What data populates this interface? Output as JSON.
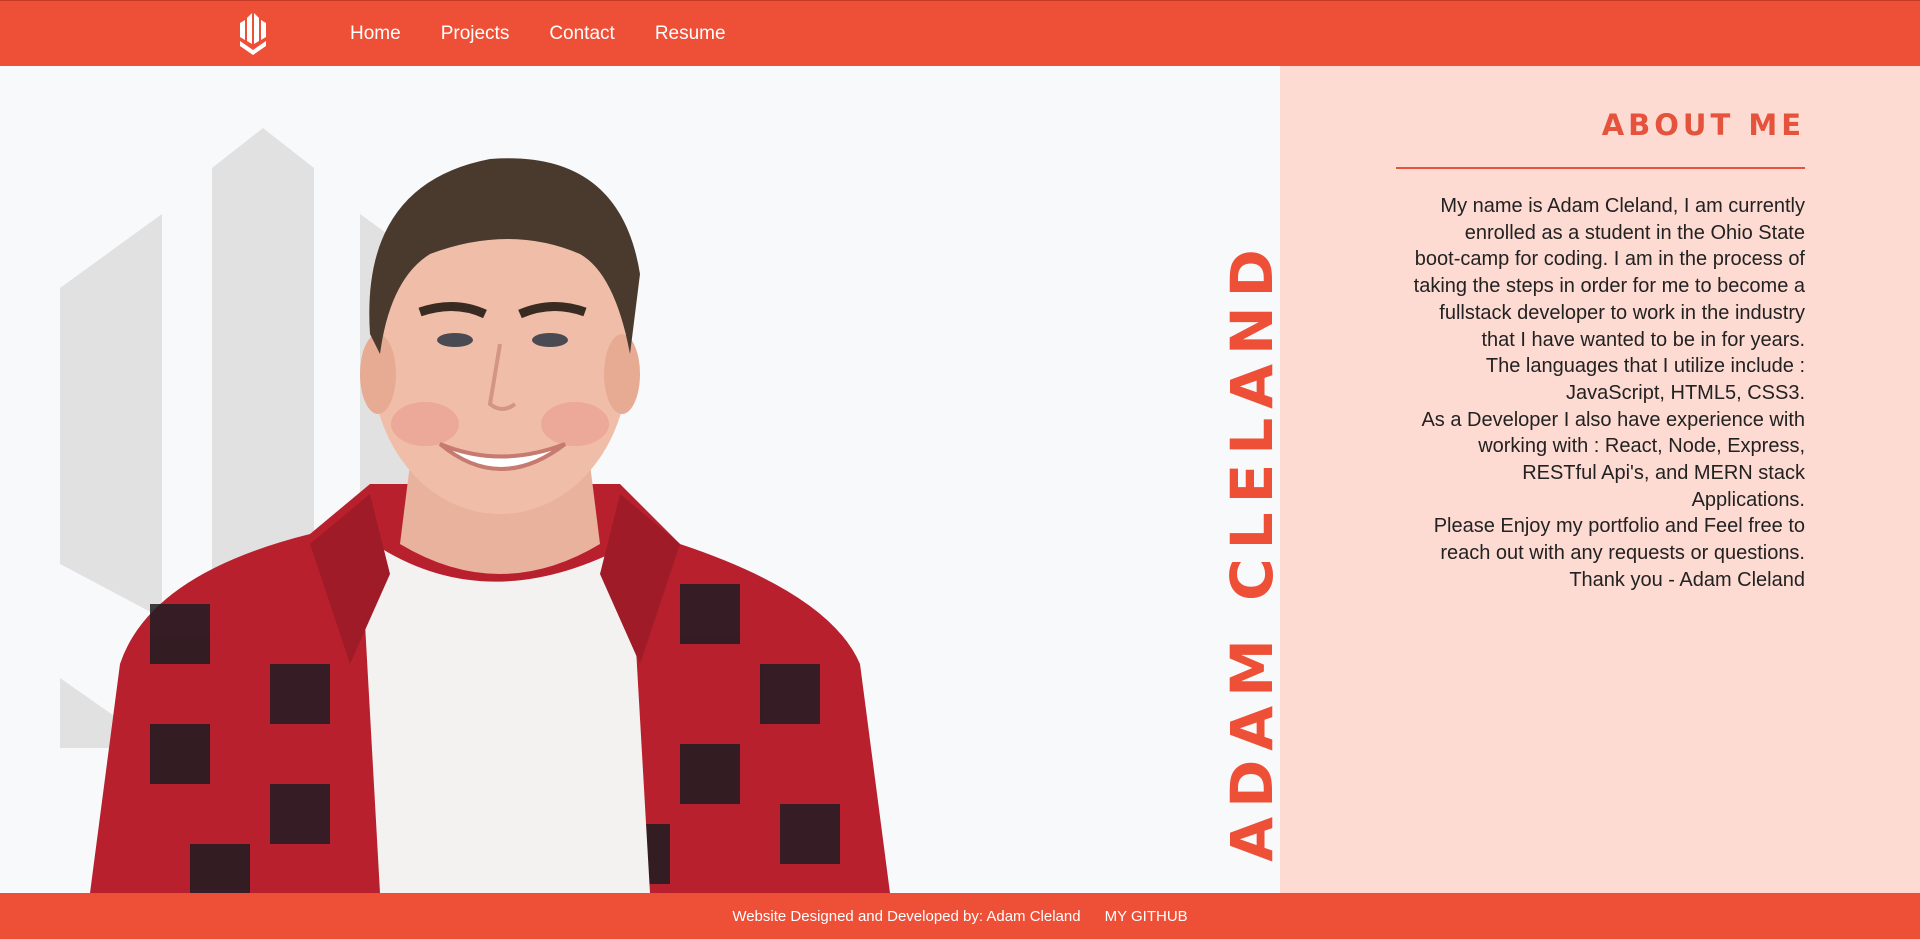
{
  "colors": {
    "brand": "#ee4f37",
    "panel": "#fddad2",
    "page": "#f7f9fb",
    "text": "#222222"
  },
  "nav": {
    "logo_icon": "hexagon-bars-logo-icon",
    "links": [
      "Home",
      "Projects",
      "Contact",
      "Resume"
    ]
  },
  "hero": {
    "name": "ADAM CLELAND",
    "background_icon": "hexagon-bars-watermark-icon",
    "portrait": "portrait-photo"
  },
  "about": {
    "title": "ABOUT ME",
    "lines": [
      "My name is Adam Cleland, I am currently",
      "enrolled as a student in the Ohio State",
      "boot-camp for coding. I am in the process of",
      "taking the steps in order for me to become a",
      "fullstack developer to work in the industry",
      "that I have wanted to be in for years.",
      "The languages that I utilize include :",
      "JavaScript, HTML5, CSS3.",
      "As a Developer I also have experience with",
      "working with : React, Node, Express,",
      "RESTful Api's, and MERN stack",
      "Applications.",
      "Please Enjoy my portfolio and Feel free to",
      "reach out with any requests or questions.",
      "Thank you - Adam Cleland"
    ]
  },
  "footer": {
    "credit": "Website Designed and Developed by: Adam Cleland",
    "github_label": "MY GITHUB"
  }
}
